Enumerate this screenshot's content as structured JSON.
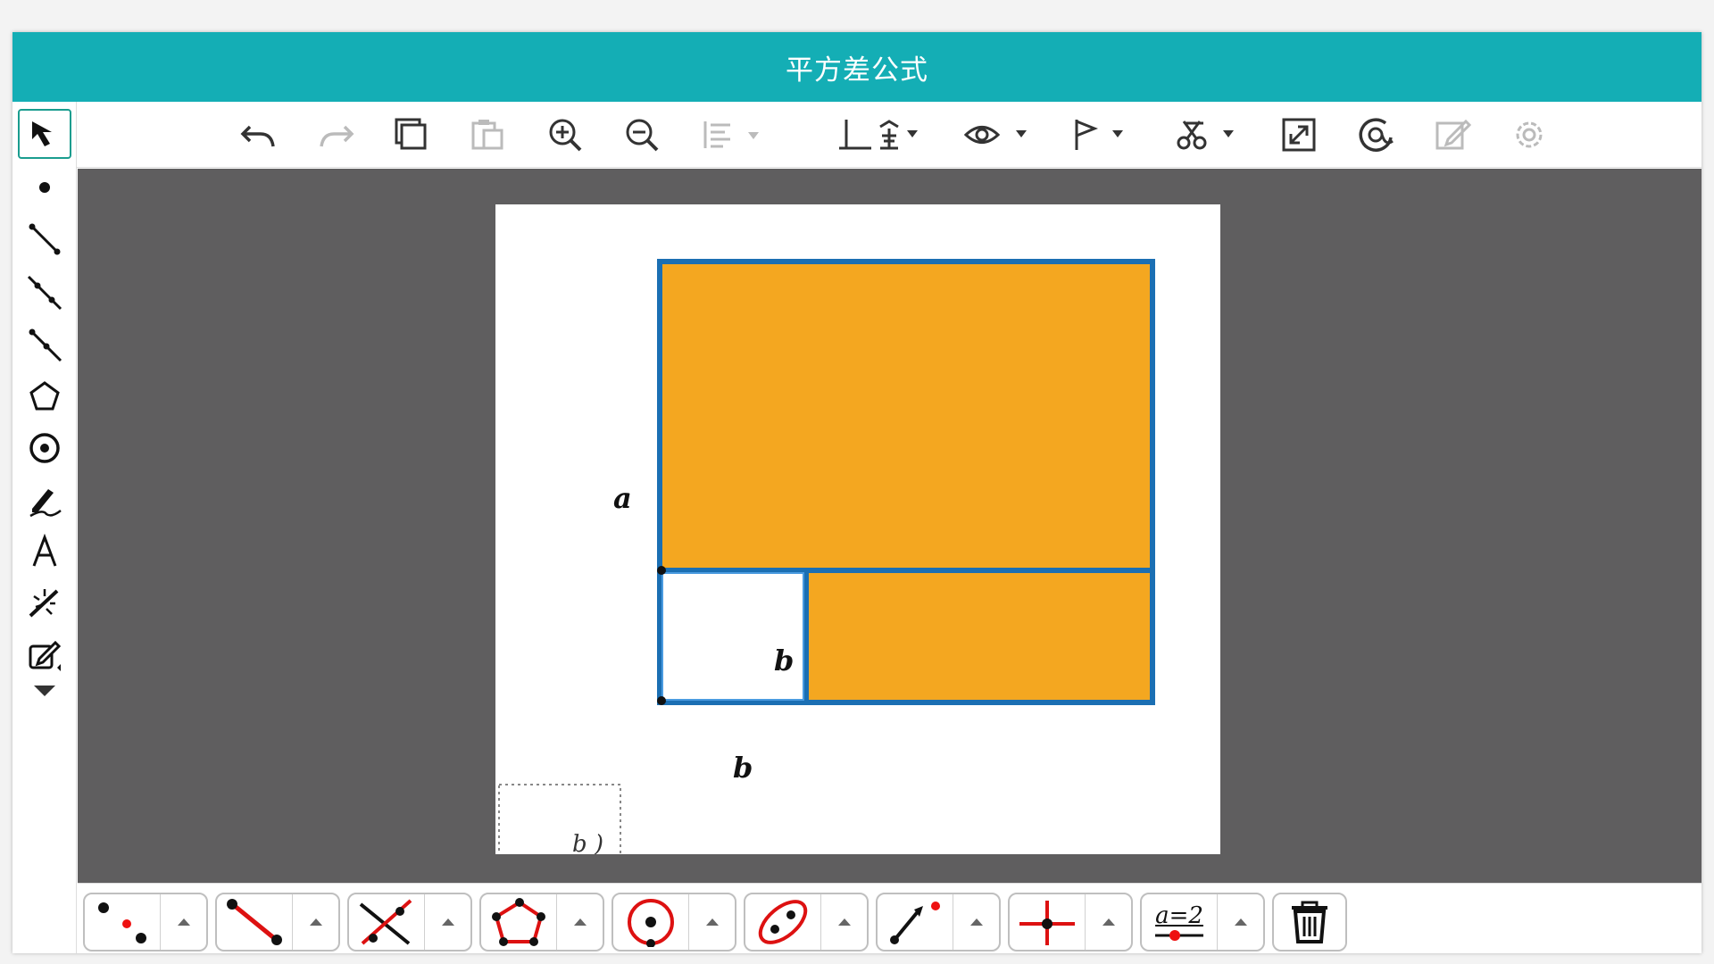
{
  "window": {
    "title": "平方差公式"
  },
  "colors": {
    "accent": "#14aeb5",
    "fill": "#f4a720",
    "stroke": "#1b6fb3",
    "canvas_bg": "#5f5e5f"
  },
  "toolbar": {
    "items": [
      "undo-icon",
      "redo-icon",
      "copy-icon",
      "paste-icon",
      "zoom-in-icon",
      "zoom-out-icon",
      "align-icon",
      "axes-grid-icon",
      "visibility-icon",
      "flag-icon",
      "style-icon",
      "fullscreen-icon",
      "view-icon",
      "edit-icon",
      "settings-icon"
    ]
  },
  "left_tools": {
    "items": [
      "select-arrow-icon",
      "point-icon",
      "segment-icon",
      "line-icon",
      "ray-icon",
      "polygon-icon",
      "circle-icon",
      "pen-icon",
      "text-icon",
      "transform-icon",
      "edit-note-icon",
      "more-icon"
    ]
  },
  "figure": {
    "label_a": "a",
    "label_b_inner": "b",
    "label_b_bottom": "b",
    "label_partial": "b )"
  },
  "bottom_tools": {
    "items": [
      "points-tool-icon",
      "segment-tool-icon",
      "intersect-tool-icon",
      "polygon-tool-icon",
      "circle-tool-icon",
      "conic-tool-icon",
      "vector-tool-icon",
      "transform-tool-icon",
      "slider-tool-icon",
      "delete-tool-icon"
    ],
    "slider_label": "a=2"
  }
}
